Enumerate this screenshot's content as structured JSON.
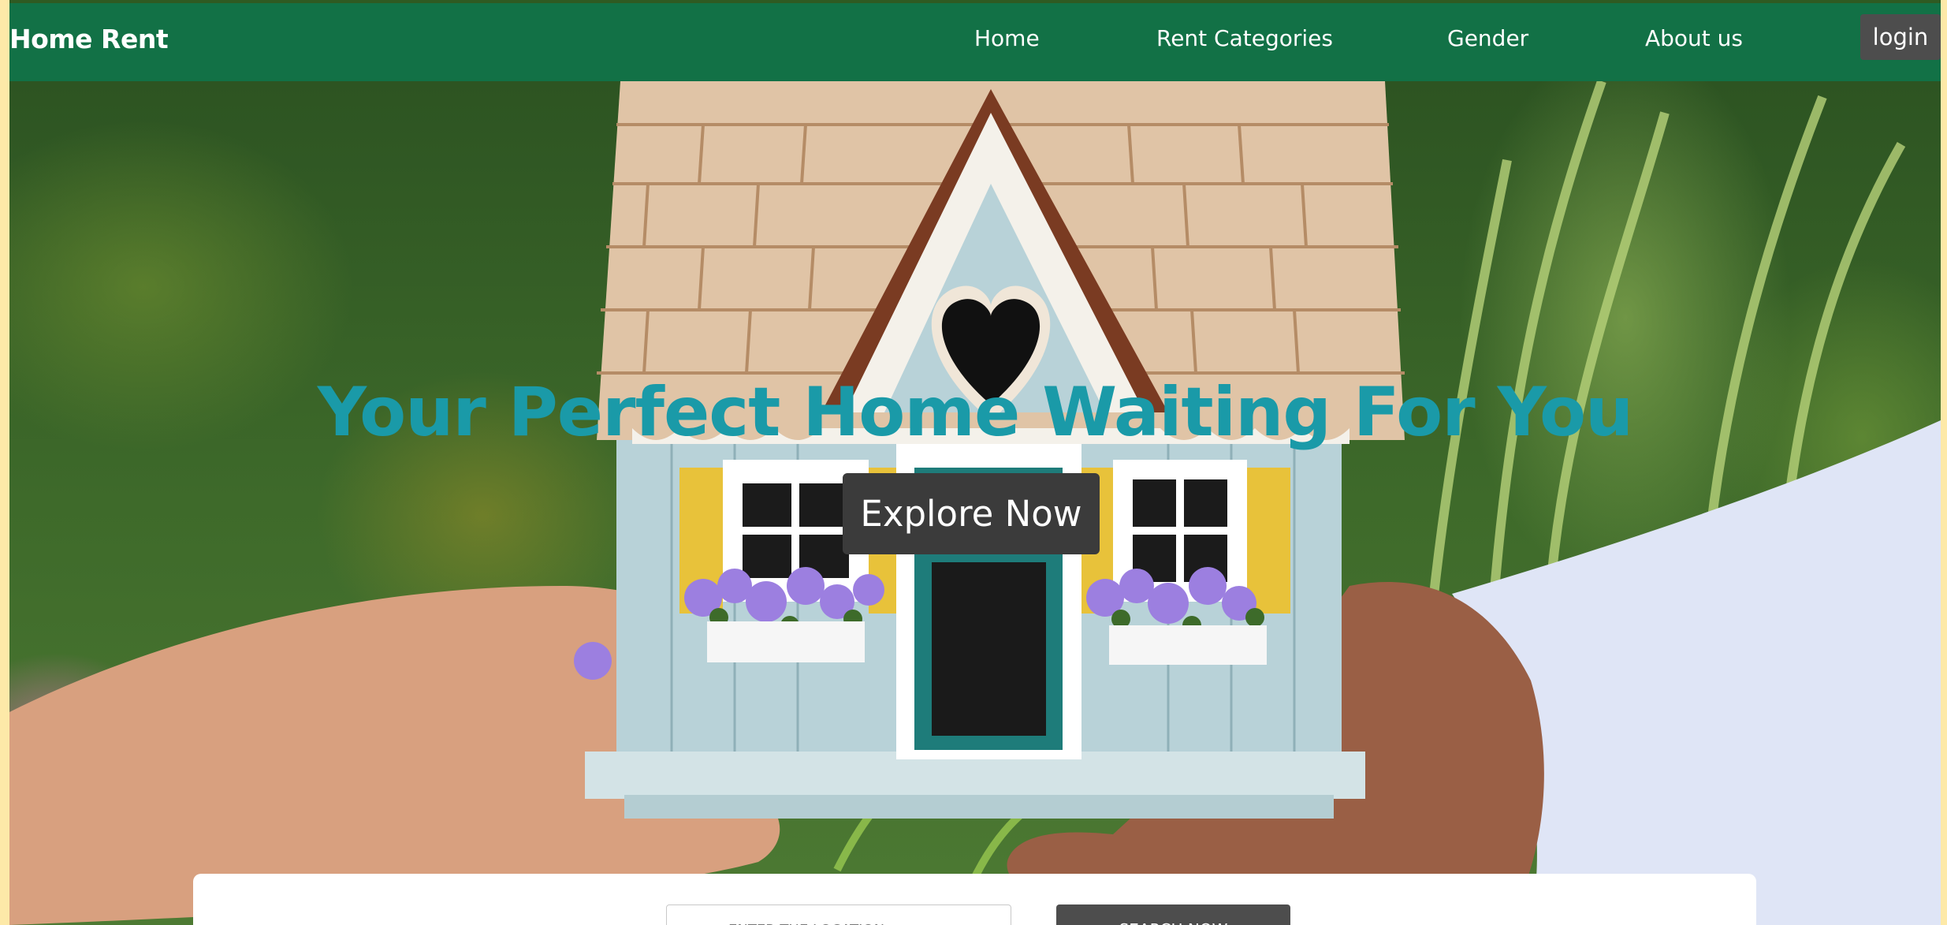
{
  "navbar": {
    "brand": "Home Rent",
    "links": [
      "Home",
      "Rent Categories",
      "Gender",
      "About us"
    ],
    "login_label": "login"
  },
  "hero": {
    "title": "Your Perfect Home Waiting For You",
    "explore_label": "Explore Now",
    "image_alt": "hands holding a miniature house"
  },
  "search": {
    "placeholder": "ENTER THE LOCATION",
    "button_label": "SEARCH NOW"
  },
  "colors": {
    "nav_green": "#127146",
    "title_teal": "#1a9aa8",
    "button_gray": "#4d4d4d",
    "page_frame": "#fde9a8"
  }
}
